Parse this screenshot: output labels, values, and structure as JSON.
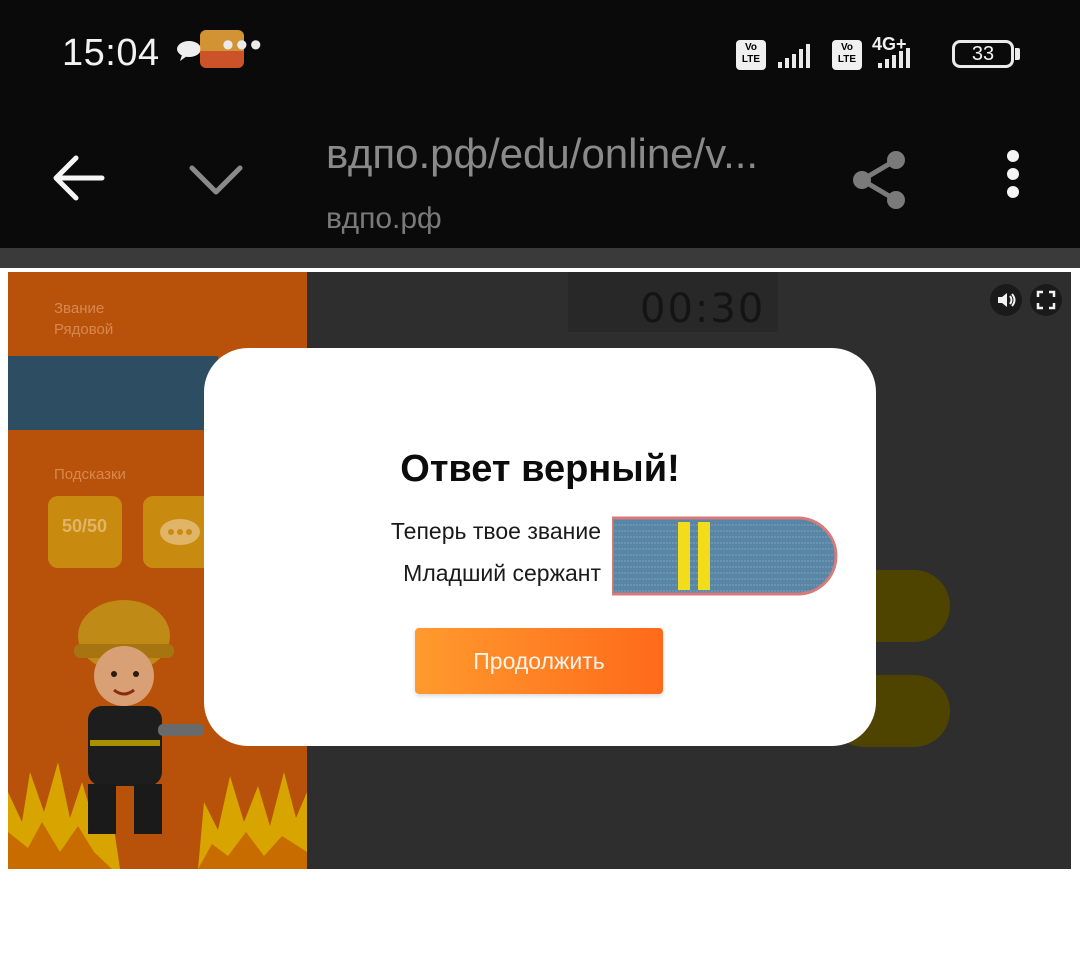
{
  "status_bar": {
    "time": "15:04",
    "volte_label": "Vo LTE",
    "network_type": "4G+",
    "battery": "33"
  },
  "browser": {
    "url": "вдпо.рф/edu/online/v...",
    "domain": "вдпо.рф"
  },
  "game": {
    "sidebar_rank_heading": "Звание",
    "sidebar_rank_value": "Рядовой",
    "sidebar_hints_heading": "Подсказки",
    "hint_fifty_label": "50/50",
    "timer": "00:30"
  },
  "modal": {
    "title": "Ответ верный!",
    "rank_line_1": "Теперь твое звание",
    "rank_line_2": "Младший сержант",
    "continue_label": "Продолжить"
  },
  "colors": {
    "accent_orange": "#ff7a22",
    "sidebar_orange": "#b8520a",
    "epaulette_blue": "#5a86a6",
    "epaulette_stripe": "#f3dc19"
  },
  "icons": [
    "back-arrow-icon",
    "chevron-down-icon",
    "share-icon",
    "more-vert-icon",
    "sound-icon",
    "fullscreen-icon",
    "chat-icon"
  ]
}
